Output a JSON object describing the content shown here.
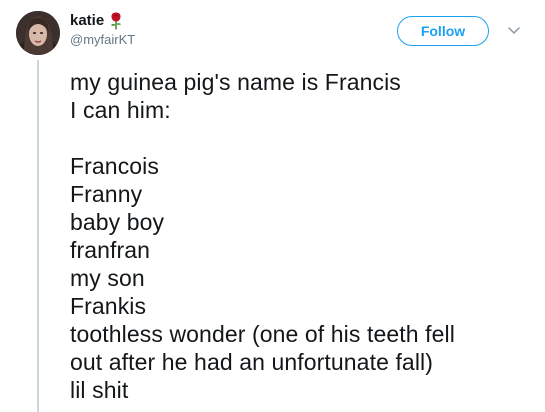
{
  "author": {
    "display_name": "katie",
    "emoji_icon": "rose-icon",
    "handle": "@myfairKT"
  },
  "actions": {
    "follow_label": "Follow",
    "more_icon": "chevron-down-icon"
  },
  "tweet": {
    "lines": [
      "my guinea pig's name is Francis",
      "I can him:",
      "",
      "Francois",
      "Franny",
      "baby boy",
      "franfran",
      "my son",
      "Frankis",
      "toothless wonder (one of his teeth fell",
      "out after he had an unfortunate fall)",
      "lil shit"
    ]
  },
  "colors": {
    "accent": "#1da1f2",
    "secondary_text": "#657786",
    "primary_text": "#14171a",
    "rose_red": "#c0102a",
    "thread_line": "#ccd6dd"
  }
}
